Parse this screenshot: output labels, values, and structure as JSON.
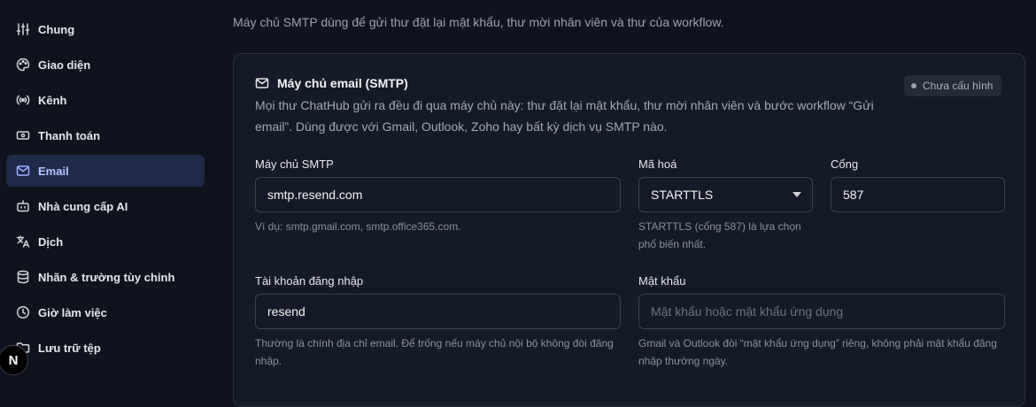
{
  "sidebar": {
    "items": [
      {
        "label": "Chung",
        "icon": "sliders-icon"
      },
      {
        "label": "Giao diện",
        "icon": "palette-icon"
      },
      {
        "label": "Kênh",
        "icon": "broadcast-icon"
      },
      {
        "label": "Thanh toán",
        "icon": "banknote-icon"
      },
      {
        "label": "Email",
        "icon": "mail-icon",
        "active": true
      },
      {
        "label": "Nhà cung cấp AI",
        "icon": "bot-icon"
      },
      {
        "label": "Dịch",
        "icon": "languages-icon"
      },
      {
        "label": "Nhãn & trường tùy chỉnh",
        "icon": "database-icon"
      },
      {
        "label": "Giờ làm việc",
        "icon": "clock-icon"
      },
      {
        "label": "Lưu trữ tệp",
        "icon": "folder-icon"
      }
    ]
  },
  "next_badge": "N",
  "intro": "Máy chủ SMTP dùng để gửi thư đặt lại mật khẩu, thư mời nhân viên và thư của workflow.",
  "card": {
    "title": "Máy chủ email (SMTP)",
    "description": "Mọi thư ChatHub gửi ra đều đi qua máy chủ này: thư đặt lại mật khẩu, thư mời nhân viên và bước workflow “Gửi email”. Dùng được với Gmail, Outlook, Zoho hay bất kỳ dịch vụ SMTP nào.",
    "status": "Chưa cấu hình"
  },
  "fields": {
    "host": {
      "label": "Máy chủ SMTP",
      "value": "smtp.resend.com",
      "help": "Ví dụ: smtp.gmail.com, smtp.office365.com."
    },
    "encryption": {
      "label": "Mã hoá",
      "value": "STARTTLS",
      "help": "STARTTLS (cổng 587) là lựa chọn phổ biến nhất."
    },
    "port": {
      "label": "Cổng",
      "value": "587"
    },
    "username": {
      "label": "Tài khoản đăng nhập",
      "value": "resend",
      "help": "Thường là chính địa chỉ email. Để trống nếu máy chủ nội bộ không đòi đăng nhập."
    },
    "password": {
      "label": "Mật khẩu",
      "placeholder": "Mật khẩu hoặc mật khẩu ứng dụng",
      "help": "Gmail và Outlook đòi “mật khẩu ứng dụng” riêng, không phải mật khẩu đăng nhập thường ngày."
    }
  }
}
